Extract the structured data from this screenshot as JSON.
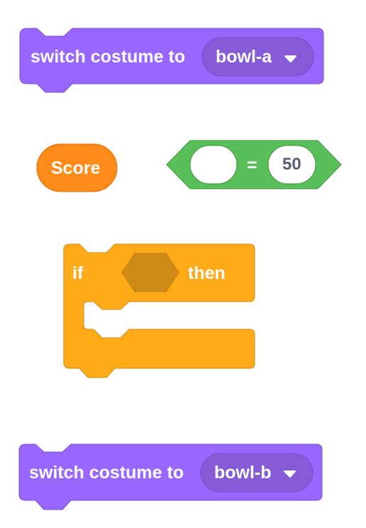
{
  "colors": {
    "looks": "#9966FF",
    "looks_dark": "#855CD6",
    "looks_border": "#774DCB",
    "variable": "#FF8C1A",
    "variable_border": "#DB6E00",
    "operator": "#59C059",
    "operator_border": "#389438",
    "control": "#FFAB19",
    "control_border": "#CF8B17",
    "slot": "#CF8B17"
  },
  "blocks": {
    "switch_costume_1": {
      "label": "switch costume to",
      "menu_value": "bowl-a",
      "menu_icon": "dropdown-caret-icon"
    },
    "score_reporter": {
      "label": "Score"
    },
    "equals_operator": {
      "left_value": "",
      "operator": "=",
      "right_value": "50"
    },
    "if_then": {
      "if_label": "if",
      "then_label": "then"
    },
    "switch_costume_2": {
      "label": "switch costume to",
      "menu_value": "bowl-b",
      "menu_icon": "dropdown-caret-icon"
    }
  }
}
